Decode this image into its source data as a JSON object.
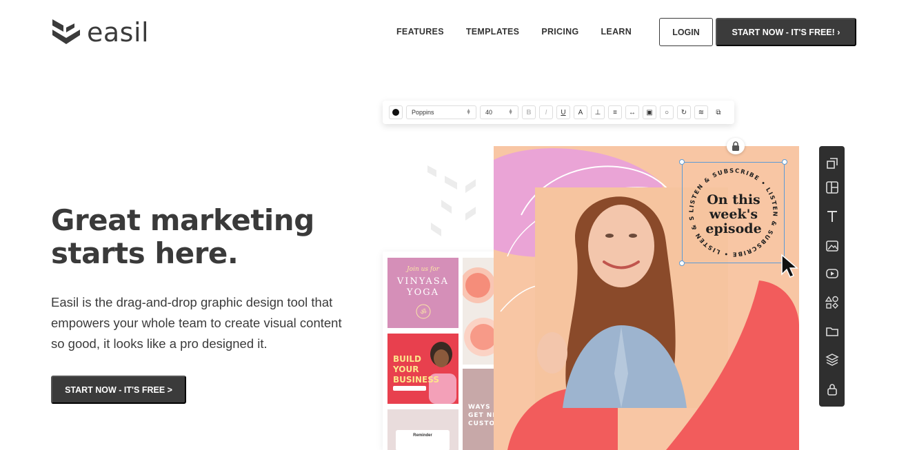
{
  "header": {
    "logo_text": "easil",
    "nav": [
      "FEATURES",
      "TEMPLATES",
      "PRICING",
      "LEARN"
    ],
    "login_label": "LOGIN",
    "start_label": "START NOW - IT'S FREE! ›"
  },
  "hero": {
    "title_line1": "Great marketing",
    "title_line2": "starts here.",
    "description": "Easil is the drag-and-drop graphic design tool that empowers your whole team to create visual content so good, it looks like a pro designed it.",
    "cta_label": "START NOW - IT'S FREE >"
  },
  "editor": {
    "toolbar": {
      "font_family": "Poppins",
      "font_size": "40",
      "icons": [
        "bold-icon",
        "italic-icon",
        "underline-icon",
        "letter-spacing-icon",
        "line-height-icon",
        "align-center-icon",
        "resize-icon",
        "effects-icon",
        "circle-text-icon",
        "rotate-icon",
        "layers-icon",
        "duplicate-icon"
      ]
    },
    "canvas": {
      "badge_line1": "On this",
      "badge_line2": "week's",
      "badge_line3": "episode",
      "circular_text": "LISTEN & SUBSCRIBE • LISTEN & SUBSCRIBE • LISTEN & SUBSCRIBE •"
    },
    "templates": {
      "t1_join": "Join us for",
      "t1_line1": "VINYASA",
      "t1_line2": "YOGA",
      "t3_line1": "BUILD",
      "t3_line2": "YOUR",
      "t3_line3": "BUSINESS",
      "t4_line1": "WAYS",
      "t4_line2": "GET NE",
      "t4_line3": "CUSTO",
      "t5_label": "Reminder"
    },
    "side_tools": [
      "resize-icon",
      "layout-icon",
      "text-icon",
      "image-icon",
      "video-icon",
      "shapes-icon",
      "folder-icon",
      "layers-icon",
      "lock-icon"
    ]
  },
  "colors": {
    "dark": "#3b3b3b",
    "canvas_peach": "#f8c6a4",
    "pink": "#e8a8d8",
    "coral": "#f25c5c",
    "selection_blue": "#5b9bd6"
  }
}
